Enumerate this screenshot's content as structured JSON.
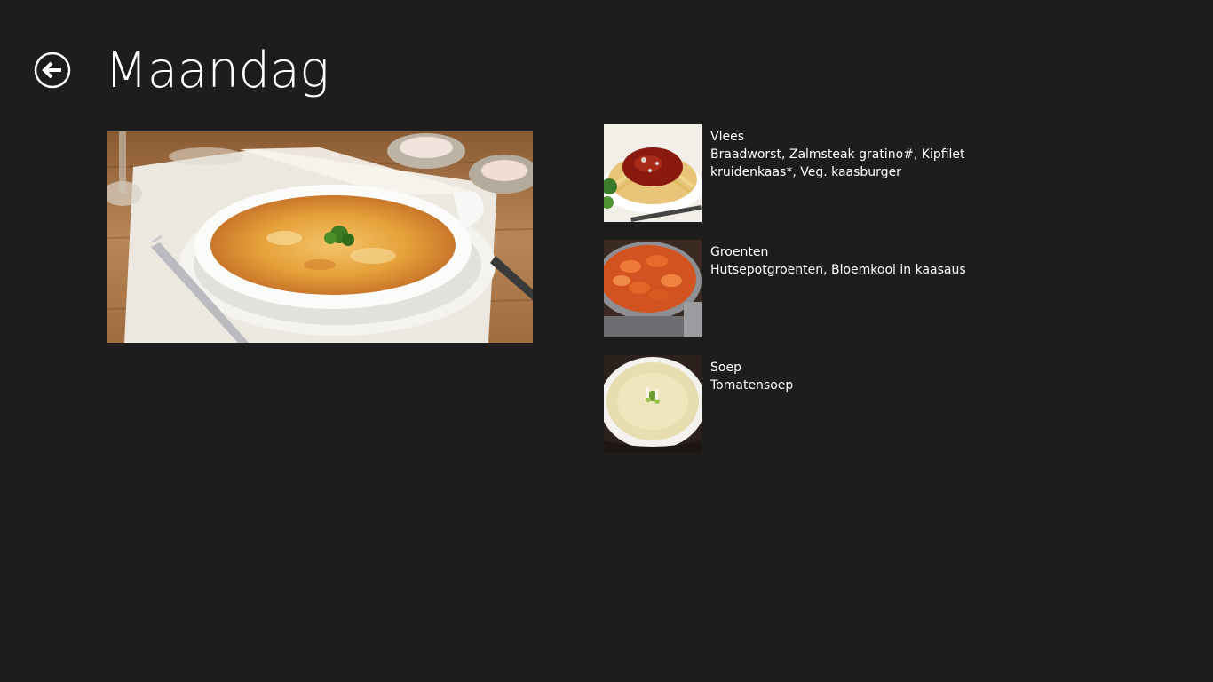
{
  "page": {
    "title": "Maandag",
    "back_icon": "back-arrow-icon"
  },
  "hero": {
    "image": "casserole-dish-photo"
  },
  "menu_items": [
    {
      "title": "Vlees",
      "description": "Braadworst, Zalmsteak gratino#, Kipfilet kruidenkaas*, Veg. kaasburger",
      "image": "spaghetti-bolognese-photo"
    },
    {
      "title": "Groenten",
      "description": "Hutsepotgroenten, Bloemkool in kaasaus",
      "image": "carrots-pan-photo"
    },
    {
      "title": "Soep",
      "description": "Tomatensoep",
      "image": "soup-bowl-photo"
    }
  ],
  "colors": {
    "background": "#1d1d1d",
    "text": "#ffffff"
  }
}
